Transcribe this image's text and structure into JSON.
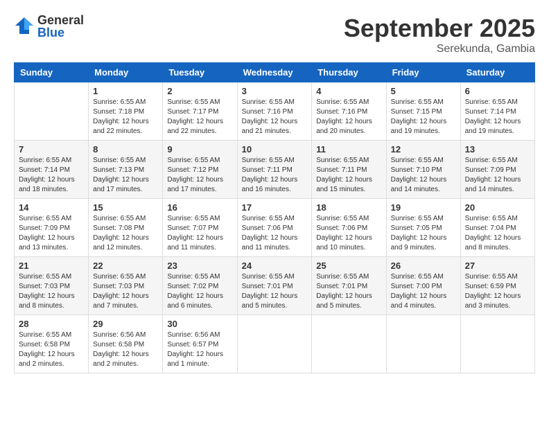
{
  "header": {
    "logo_general": "General",
    "logo_blue": "Blue",
    "title": "September 2025",
    "subtitle": "Serekunda, Gambia"
  },
  "days_of_week": [
    "Sunday",
    "Monday",
    "Tuesday",
    "Wednesday",
    "Thursday",
    "Friday",
    "Saturday"
  ],
  "weeks": [
    [
      {
        "day": "",
        "info": ""
      },
      {
        "day": "1",
        "info": "Sunrise: 6:55 AM\nSunset: 7:18 PM\nDaylight: 12 hours\nand 22 minutes."
      },
      {
        "day": "2",
        "info": "Sunrise: 6:55 AM\nSunset: 7:17 PM\nDaylight: 12 hours\nand 22 minutes."
      },
      {
        "day": "3",
        "info": "Sunrise: 6:55 AM\nSunset: 7:16 PM\nDaylight: 12 hours\nand 21 minutes."
      },
      {
        "day": "4",
        "info": "Sunrise: 6:55 AM\nSunset: 7:16 PM\nDaylight: 12 hours\nand 20 minutes."
      },
      {
        "day": "5",
        "info": "Sunrise: 6:55 AM\nSunset: 7:15 PM\nDaylight: 12 hours\nand 19 minutes."
      },
      {
        "day": "6",
        "info": "Sunrise: 6:55 AM\nSunset: 7:14 PM\nDaylight: 12 hours\nand 19 minutes."
      }
    ],
    [
      {
        "day": "7",
        "info": "Sunrise: 6:55 AM\nSunset: 7:14 PM\nDaylight: 12 hours\nand 18 minutes."
      },
      {
        "day": "8",
        "info": "Sunrise: 6:55 AM\nSunset: 7:13 PM\nDaylight: 12 hours\nand 17 minutes."
      },
      {
        "day": "9",
        "info": "Sunrise: 6:55 AM\nSunset: 7:12 PM\nDaylight: 12 hours\nand 17 minutes."
      },
      {
        "day": "10",
        "info": "Sunrise: 6:55 AM\nSunset: 7:11 PM\nDaylight: 12 hours\nand 16 minutes."
      },
      {
        "day": "11",
        "info": "Sunrise: 6:55 AM\nSunset: 7:11 PM\nDaylight: 12 hours\nand 15 minutes."
      },
      {
        "day": "12",
        "info": "Sunrise: 6:55 AM\nSunset: 7:10 PM\nDaylight: 12 hours\nand 14 minutes."
      },
      {
        "day": "13",
        "info": "Sunrise: 6:55 AM\nSunset: 7:09 PM\nDaylight: 12 hours\nand 14 minutes."
      }
    ],
    [
      {
        "day": "14",
        "info": "Sunrise: 6:55 AM\nSunset: 7:09 PM\nDaylight: 12 hours\nand 13 minutes."
      },
      {
        "day": "15",
        "info": "Sunrise: 6:55 AM\nSunset: 7:08 PM\nDaylight: 12 hours\nand 12 minutes."
      },
      {
        "day": "16",
        "info": "Sunrise: 6:55 AM\nSunset: 7:07 PM\nDaylight: 12 hours\nand 11 minutes."
      },
      {
        "day": "17",
        "info": "Sunrise: 6:55 AM\nSunset: 7:06 PM\nDaylight: 12 hours\nand 11 minutes."
      },
      {
        "day": "18",
        "info": "Sunrise: 6:55 AM\nSunset: 7:06 PM\nDaylight: 12 hours\nand 10 minutes."
      },
      {
        "day": "19",
        "info": "Sunrise: 6:55 AM\nSunset: 7:05 PM\nDaylight: 12 hours\nand 9 minutes."
      },
      {
        "day": "20",
        "info": "Sunrise: 6:55 AM\nSunset: 7:04 PM\nDaylight: 12 hours\nand 8 minutes."
      }
    ],
    [
      {
        "day": "21",
        "info": "Sunrise: 6:55 AM\nSunset: 7:03 PM\nDaylight: 12 hours\nand 8 minutes."
      },
      {
        "day": "22",
        "info": "Sunrise: 6:55 AM\nSunset: 7:03 PM\nDaylight: 12 hours\nand 7 minutes."
      },
      {
        "day": "23",
        "info": "Sunrise: 6:55 AM\nSunset: 7:02 PM\nDaylight: 12 hours\nand 6 minutes."
      },
      {
        "day": "24",
        "info": "Sunrise: 6:55 AM\nSunset: 7:01 PM\nDaylight: 12 hours\nand 5 minutes."
      },
      {
        "day": "25",
        "info": "Sunrise: 6:55 AM\nSunset: 7:01 PM\nDaylight: 12 hours\nand 5 minutes."
      },
      {
        "day": "26",
        "info": "Sunrise: 6:55 AM\nSunset: 7:00 PM\nDaylight: 12 hours\nand 4 minutes."
      },
      {
        "day": "27",
        "info": "Sunrise: 6:55 AM\nSunset: 6:59 PM\nDaylight: 12 hours\nand 3 minutes."
      }
    ],
    [
      {
        "day": "28",
        "info": "Sunrise: 6:55 AM\nSunset: 6:58 PM\nDaylight: 12 hours\nand 2 minutes."
      },
      {
        "day": "29",
        "info": "Sunrise: 6:56 AM\nSunset: 6:58 PM\nDaylight: 12 hours\nand 2 minutes."
      },
      {
        "day": "30",
        "info": "Sunrise: 6:56 AM\nSunset: 6:57 PM\nDaylight: 12 hours\nand 1 minute."
      },
      {
        "day": "",
        "info": ""
      },
      {
        "day": "",
        "info": ""
      },
      {
        "day": "",
        "info": ""
      },
      {
        "day": "",
        "info": ""
      }
    ]
  ]
}
